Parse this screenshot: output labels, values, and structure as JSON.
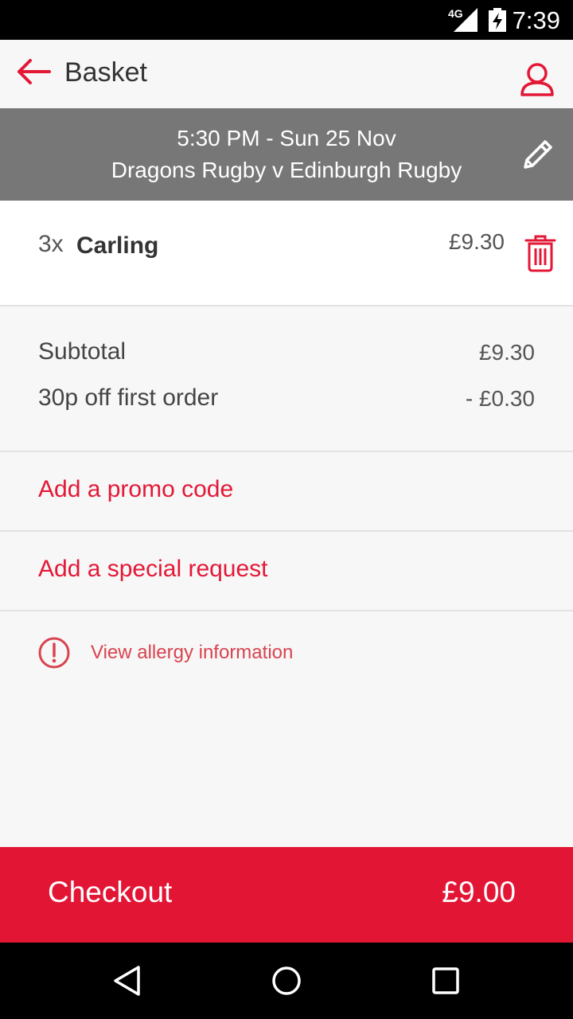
{
  "status_bar": {
    "network": "4G",
    "time": "7:39"
  },
  "app_bar": {
    "title": "Basket"
  },
  "event": {
    "datetime": "5:30 PM - Sun 25 Nov",
    "match": "Dragons Rugby v Edinburgh Rugby"
  },
  "basket": {
    "items": [
      {
        "quantity": "3x",
        "name": "Carling",
        "price": "£9.30"
      }
    ]
  },
  "totals": {
    "subtotal_label": "Subtotal",
    "subtotal_value": "£9.30",
    "discount_label": "30p off first order",
    "discount_value": "- £0.30"
  },
  "actions": {
    "promo": "Add a promo code",
    "special_request": "Add a special request",
    "allergy": "View allergy information"
  },
  "checkout": {
    "label": "Checkout",
    "total": "£9.00"
  },
  "colors": {
    "accent": "#e31535",
    "header_gray": "#777777",
    "background": "#f7f7f7"
  },
  "icons": {
    "back": "arrow-left-icon",
    "account": "user-icon",
    "edit": "pencil-icon",
    "delete": "trash-icon",
    "alert": "exclamation-circle-icon"
  }
}
